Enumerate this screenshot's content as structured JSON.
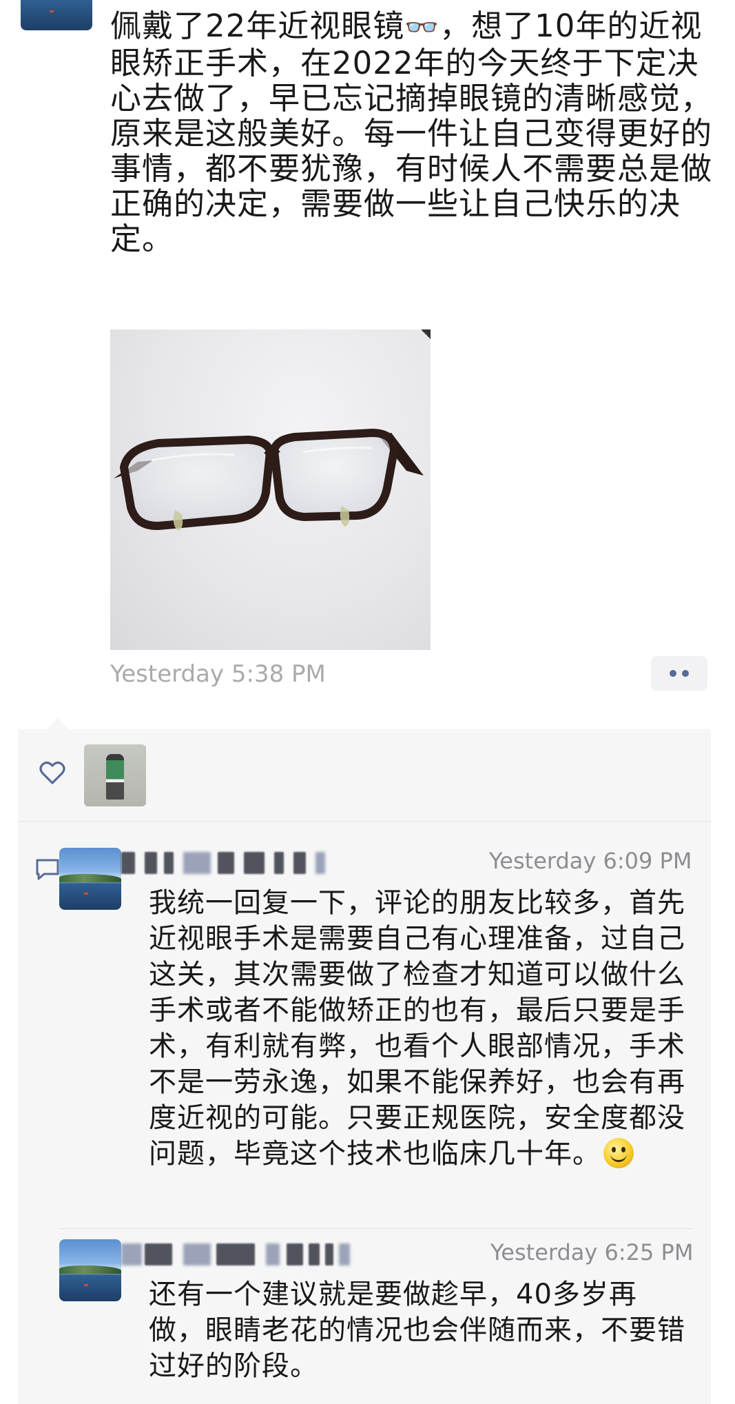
{
  "post": {
    "text": "佩戴了22年近视眼镜👓，想了10年的近视眼矫正手术，在2022年的今天终于下定决心去做了，早已忘记摘掉眼镜的清晰感觉，原来是这般美好。每一件让自己变得更好的事情，都不要犹豫，有时候人不需要总是做正确的决定，需要做一些让自己快乐的决定。",
    "text_before_emoji": "佩戴了22年近视眼镜",
    "emoji": "👓",
    "text_after_emoji": "，想了10年的近视眼矫正手术，在2022年的今天终于下定决心去做了，早已忘记摘掉眼镜的清晰感觉，原来是这般美好。每一件让自己变得更好的事情，都不要犹豫，有时候人不需要总是做正确的决定，需要做一些让自己快乐的决定。",
    "timestamp": "Yesterday 5:38 PM",
    "more_icon": "more-dots-icon"
  },
  "likes": {
    "icon": "heart-icon"
  },
  "comments": [
    {
      "time": "Yesterday 6:09 PM",
      "text": "我统一回复一下，评论的朋友比较多，首先近视眼手术是需要自己有心理准备，过自己这关，其次需要做了检查才知道可以做什么手术或者不能做矫正的也有，最后只要是手术，有利就有弊，也看个人眼部情况，手术不是一劳永逸，如果不能保养好，也会有再度近视的可能。只要正规医院，安全度都没问题，毕竟这个技术也临床几十年。",
      "emoji": "smile-emoji"
    },
    {
      "time": "Yesterday 6:25 PM",
      "text": "还有一个建议就是要做趁早，40多岁再做，眼睛老花的情况也会伴随而来，不要错过好的阶段。"
    }
  ],
  "colors": {
    "link_blue": "#576b95",
    "timestamp_gray": "#a9a9ae",
    "panel_bg": "#f6f6f7"
  }
}
